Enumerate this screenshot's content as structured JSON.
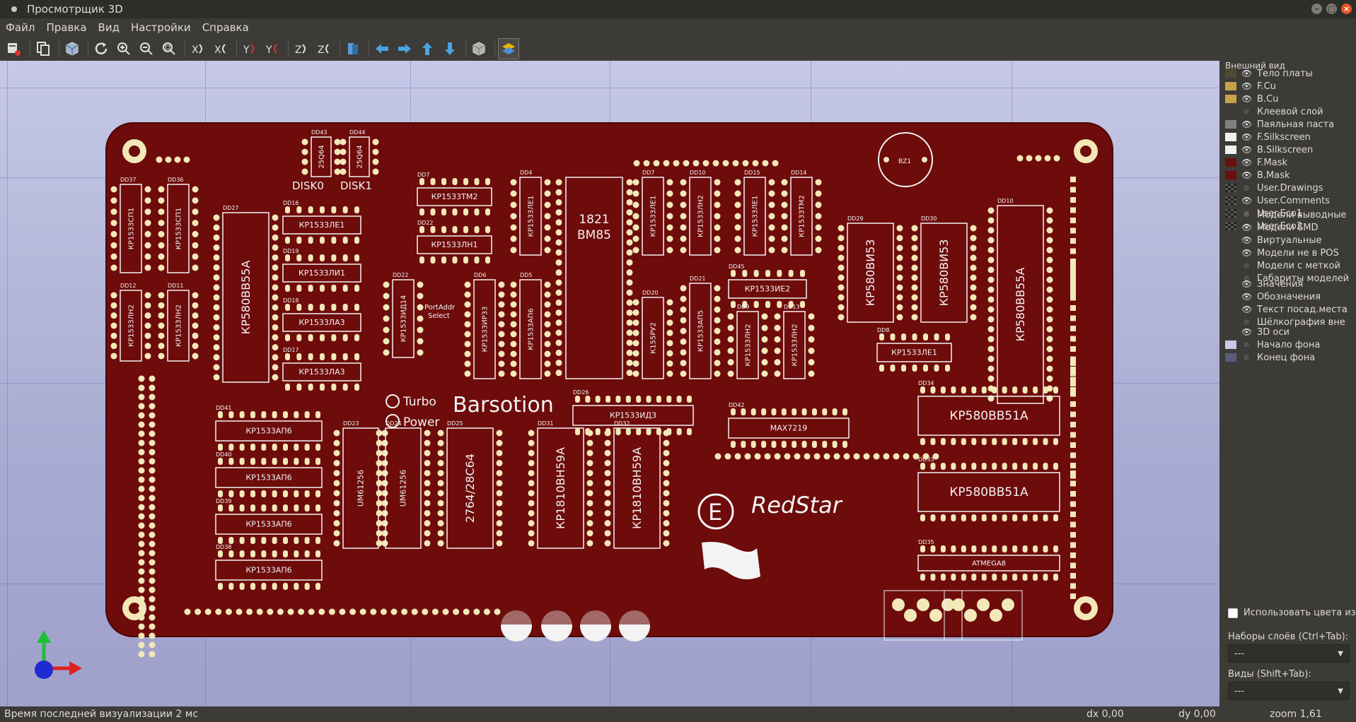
{
  "window": {
    "title": "Просмотрщик 3D"
  },
  "menu": [
    {
      "label": "Файл"
    },
    {
      "label": "Правка"
    },
    {
      "label": "Вид"
    },
    {
      "label": "Настройки"
    },
    {
      "label": "Справка"
    }
  ],
  "appearance": {
    "title": "Внешний вид",
    "layers": [
      {
        "label": "Тело платы",
        "color": "#4f4a32",
        "eye": true
      },
      {
        "label": "F.Cu",
        "color": "#c8a24a",
        "eye": true
      },
      {
        "label": "B.Cu",
        "color": "#c8a24a",
        "eye": true
      },
      {
        "label": "Клеевой слой",
        "color": "none",
        "eye": false
      },
      {
        "label": "Паяльная паста",
        "color": "#808080",
        "eye": true
      },
      {
        "label": "F.Silkscreen",
        "color": "#f0f0f0",
        "eye": true
      },
      {
        "label": "B.Silkscreen",
        "color": "#f0f0f0",
        "eye": true
      },
      {
        "label": "F.Mask",
        "color": "#6b1010",
        "eye": true
      },
      {
        "label": "B.Mask",
        "color": "#6b1010",
        "eye": true
      },
      {
        "label": "User.Drawings",
        "color": "checker",
        "eye": false
      },
      {
        "label": "User.Comments",
        "color": "checker",
        "eye": true
      },
      {
        "label": "User.Eco1",
        "color": "checker",
        "eye": false
      },
      {
        "label": "User.Eco2",
        "color": "checker",
        "eye": false
      }
    ],
    "models": [
      {
        "label": "Модели выводные",
        "eye": false
      },
      {
        "label": "Модели SMD",
        "eye": true
      },
      {
        "label": "Виртуальные",
        "eye": true
      },
      {
        "label": "Модели не в POS",
        "eye": true
      },
      {
        "label": "Модели с меткой",
        "eye": false
      },
      {
        "label": "Габариты моделей",
        "eye": false
      }
    ],
    "texts": [
      {
        "label": "Значения",
        "eye": true
      },
      {
        "label": "Обозначения",
        "eye": true
      },
      {
        "label": "Текст посад.места",
        "eye": true
      },
      {
        "label": "Шёлкография вне",
        "eye": false
      }
    ],
    "misc": [
      {
        "label": "3D оси",
        "eye": true,
        "color": "none"
      },
      {
        "label": "Начало фона",
        "eye": false,
        "color": "#c8c8e8"
      },
      {
        "label": "Конец фона",
        "eye": false,
        "color": "#5a5a7a"
      }
    ],
    "use_board_colors": "Использовать цвета из н",
    "layer_presets_label": "Наборы слоёв (Ctrl+Tab):",
    "layer_presets_value": "---",
    "views_label": "Виды (Shift+Tab):",
    "views_value": "---"
  },
  "status": {
    "left": "Время последней визуализации 2 мс",
    "dx": "dx 0,00",
    "dy": "dy 0,00",
    "zoom": "zoom 1,61"
  },
  "board": {
    "color": "#6e0b0b",
    "silk_labels": {
      "brand1": "Barsotion",
      "brand2": "RedStar",
      "turbo": "Turbo",
      "power": "Power",
      "disk0": "DISK0",
      "disk1": "DISK1",
      "portaddr1": "PortAddr",
      "portaddr2": "Select",
      "bm85a": "1821",
      "bm85b": "ВМ85"
    },
    "chips": [
      {
        "id": "dd27",
        "ref": "DD27",
        "label": "КР580ВВ55А"
      },
      {
        "id": "dd29",
        "ref": "DD29",
        "label": "КР580ВИ53"
      },
      {
        "id": "dd30",
        "ref": "DD30",
        "label": "КР580ВИ53"
      },
      {
        "id": "dd10",
        "ref": "DD10",
        "label": "КР580ВВ55А"
      },
      {
        "id": "dd34",
        "ref": "DD34",
        "label": "КР580ВВ51А"
      },
      {
        "id": "dd33",
        "ref": "DD33",
        "label": "КР580ВВ51А"
      },
      {
        "id": "dd25",
        "ref": "DD25",
        "label": "2764/28С64"
      },
      {
        "id": "dd31",
        "ref": "DD31",
        "label": "КР1810ВН59А"
      },
      {
        "id": "dd32",
        "ref": "DD32",
        "label": "КР1810ВН59А"
      },
      {
        "id": "dd23",
        "ref": "DD23",
        "label": "UM61256"
      },
      {
        "id": "dd24",
        "ref": "DD24",
        "label": "UM61256"
      },
      {
        "id": "dd41",
        "ref": "DD41",
        "label": "КР1533АП6"
      },
      {
        "id": "dd40",
        "ref": "DD40",
        "label": "КР1533АП6"
      },
      {
        "id": "dd39",
        "ref": "DD39",
        "label": "КР1533АП6"
      },
      {
        "id": "dd38",
        "ref": "DD38",
        "label": "КР1533АП6"
      },
      {
        "id": "dd16",
        "ref": "DD16",
        "label": "КР1533ЛЕ1"
      },
      {
        "id": "dd19",
        "ref": "DD19",
        "label": "КР1533ЛИ1"
      },
      {
        "id": "dd18",
        "ref": "DD18",
        "label": "КР1533ЛА3"
      },
      {
        "id": "dd17",
        "ref": "DD17",
        "label": "КР1533ЛА3"
      },
      {
        "id": "dd7",
        "ref": "DD7",
        "label": "КР1533ТМ2"
      },
      {
        "id": "dd22b",
        "ref": "DD22",
        "label": "КР1533ЛН1"
      },
      {
        "id": "dd45",
        "ref": "DD45",
        "label": "КР1533ИЕ2"
      },
      {
        "id": "dd26",
        "ref": "DD26",
        "label": "КР1533ИД3"
      },
      {
        "id": "dd42",
        "ref": "DD42",
        "label": "MAX7219"
      },
      {
        "id": "dd35",
        "ref": "DD35",
        "label": "ATMEGA8"
      },
      {
        "id": "dd8",
        "ref": "DD8",
        "label": "КР1533ЛЕ1"
      },
      {
        "id": "dd37",
        "ref": "DD37",
        "label": "КР1533СП1"
      },
      {
        "id": "dd36",
        "ref": "DD36",
        "label": "КР1533СП1"
      },
      {
        "id": "dd12",
        "ref": "DD12",
        "label": "КР1533ЛН2"
      },
      {
        "id": "dd11",
        "ref": "DD11",
        "label": "КР1533ЛН2"
      },
      {
        "id": "dd22",
        "ref": "DD22",
        "label": "КР1533ИД14"
      },
      {
        "id": "dd6",
        "ref": "DD6",
        "label": "КР1533ИР33"
      },
      {
        "id": "dd5",
        "ref": "DD5",
        "label": "КР1533АП6"
      },
      {
        "id": "dd4",
        "ref": "DD4",
        "label": "КР1533ЛЕ1"
      },
      {
        "id": "ddp",
        "ref": "DD7",
        "label": "КР1533ЛЕ1"
      },
      {
        "id": "ddq",
        "ref": "DD10",
        "label": "КР1533ЛН2"
      },
      {
        "id": "dd15",
        "ref": "DD15",
        "label": "КР1533ЛЕ1"
      },
      {
        "id": "dd14",
        "ref": "DD14",
        "label": "КР1533ТМ2"
      },
      {
        "id": "dd20",
        "ref": "DD20",
        "label": "К155РУ2"
      },
      {
        "id": "dd21",
        "ref": "DD21",
        "label": "КР1533АП5"
      },
      {
        "id": "dd9",
        "ref": "DD9",
        "label": "КР1533ЛН2"
      },
      {
        "id": "dd13",
        "ref": "DD13",
        "label": "КР1533ЛН2"
      },
      {
        "id": "dd43",
        "ref": "DD43",
        "label": "25Q64"
      },
      {
        "id": "dd44",
        "ref": "DD44",
        "label": "25Q64"
      }
    ]
  }
}
